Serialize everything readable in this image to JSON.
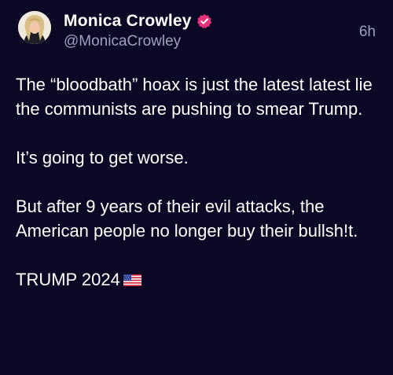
{
  "author": {
    "name": "Monica Crowley",
    "handle": "@MonicaCrowley",
    "verified": true,
    "verified_badge_color": "#e5327a"
  },
  "timestamp": "6h",
  "post": {
    "paragraphs": [
      "The “bloodbath” hoax is just the latest latest lie the communists are pushing to smear Trump.",
      "It’s going to get worse.",
      "But after 9 years of their evil attacks, the American people no longer buy their bullsh!t."
    ],
    "final_line": "TRUMP 2024",
    "final_emoji": "us-flag-emoji"
  },
  "colors": {
    "background": "#0b0826",
    "text": "#ffffff",
    "secondary_text": "#9ea3b8"
  }
}
